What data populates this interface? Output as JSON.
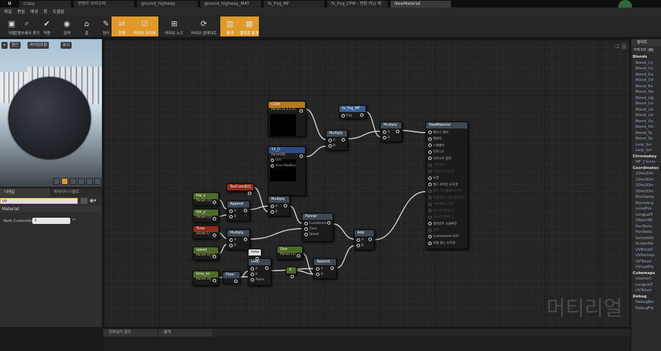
{
  "tabs": [
    "crazy",
    "콘텐츠 브라우저",
    "ground_highway",
    "ground_highway_MAT",
    "fx_Fog_MF",
    "fx_Fog_CPM - 변환 러닝 에",
    "NewMaterial"
  ],
  "menu": [
    "파일",
    "편집",
    "애셋",
    "창",
    "도움말"
  ],
  "toolbar": [
    {
      "label": "저장",
      "icon": "save-icon",
      "glyph": "▣",
      "active": false
    },
    {
      "label": "콘텐츠에서 찾기",
      "icon": "search-icon",
      "glyph": "⌕",
      "active": false
    },
    {
      "label": "적용",
      "icon": "check-icon",
      "glyph": "✔",
      "active": false
    },
    {
      "label": "검색",
      "icon": "binoculars-icon",
      "glyph": "◉",
      "active": false
    },
    {
      "label": "홈",
      "icon": "home-icon",
      "glyph": "⌂",
      "active": false
    },
    {
      "label": "정리",
      "icon": "broom-icon",
      "glyph": "✎",
      "active": false
    },
    {
      "label": "연결",
      "icon": "connect-icon",
      "glyph": "⇄",
      "active": true
    },
    {
      "label": "라이브 프리뷰",
      "icon": "preview-icon",
      "glyph": "☑",
      "active": true
    },
    {
      "label": "라이브 노드",
      "icon": "live-node-icon",
      "glyph": "⊞",
      "active": false
    },
    {
      "label": "라이브 업데이트",
      "icon": "live-update-icon",
      "glyph": "⟳",
      "active": false
    },
    {
      "label": "통계",
      "icon": "stats-icon",
      "glyph": "▥",
      "active": true
    },
    {
      "label": "플랫폼 통계",
      "icon": "platform-stats-icon",
      "glyph": "▦",
      "active": true
    }
  ],
  "viewport": {
    "btn_perspective": "원근",
    "btn_lit": "라이팅포함",
    "btn_show": "표시"
  },
  "details": {
    "tab1": "디테일",
    "tab2": "파라미터 디폴트",
    "search_value": "uv",
    "section": "Material",
    "prop_label": "Num Customized UVs",
    "prop_value": "1"
  },
  "graph": {
    "zoom": "-2 줌",
    "watermark": "머티리얼"
  },
  "nodes": [
    {
      "id": "color",
      "title": "Color",
      "sub": "Param (1,1,1,1)",
      "color": "#b7771b"
    },
    {
      "id": "tex",
      "title": "TX_D",
      "sub": "Param2D",
      "color": "#2a4c80",
      "pins": [
        "UVs",
        "View MipBias"
      ]
    },
    {
      "id": "fogmf",
      "title": "fx_Fog_MF",
      "color": "#3a5d94",
      "pins": [
        "Fog"
      ]
    },
    {
      "id": "mul1",
      "title": "Multiply",
      "pins": [
        "A",
        "B"
      ]
    },
    {
      "id": "mul2",
      "title": "Multiply",
      "pins": [
        "A",
        "B"
      ]
    },
    {
      "id": "texcoord",
      "title": "TexCoord[0]",
      "color": "#8d2a1a"
    },
    {
      "id": "tilex",
      "title": "tile_x",
      "sub": "Param (1)",
      "color": "#4d6b25"
    },
    {
      "id": "tiley",
      "title": "tile_y",
      "sub": "Param (1)",
      "color": "#4d6b25"
    },
    {
      "id": "append1",
      "title": "Append",
      "pins": [
        "A",
        "B"
      ]
    },
    {
      "id": "mul3",
      "title": "Multiply",
      "pins": [
        "A",
        "B"
      ]
    },
    {
      "id": "time",
      "title": "Time",
      "sub": "(Scale 1)",
      "color": "#8d2a1a"
    },
    {
      "id": "mul4",
      "title": "Multiply",
      "pins": [
        "A",
        "B"
      ]
    },
    {
      "id": "panner",
      "title": "Panner",
      "pins": [
        "Coordinate",
        "Time",
        "Speed"
      ]
    },
    {
      "id": "add",
      "title": "Add",
      "pins": [
        "A",
        "B"
      ]
    },
    {
      "id": "speed",
      "title": "speed",
      "sub": "Param (0.1)",
      "color": "#4d6b25"
    },
    {
      "id": "lerp",
      "title": "Lerp",
      "pins": [
        "A",
        "B",
        "Alpha"
      ]
    },
    {
      "id": "one",
      "title": "One",
      "sub": "Param (1)",
      "color": "#4d6b25"
    },
    {
      "id": "append2",
      "title": "Append",
      "pins": [
        "A",
        "B"
      ]
    },
    {
      "id": "timeon",
      "title": "time_on",
      "sub": "Param (0)",
      "color": "#4d6b25"
    },
    {
      "id": "floor",
      "title": "Floor"
    },
    {
      "id": "zero",
      "title": "0",
      "color": "#4d6b25"
    },
    {
      "id": "timecomment",
      "title": "time"
    },
    {
      "id": "result",
      "title": "NewMaterial",
      "pins": [
        "베이스 컬러",
        "메탈릭",
        "스페큘러",
        "러프니스",
        "이미시브 컬러",
        "오파시티",
        "오파시티 마스크",
        "노멀",
        "월드 포지션 오프셋",
        "월드 디스플레이스먼트",
        "테셀레이션 멀티플라이어",
        "서브서피스 컬러",
        "커스텀 데이터 0",
        "커스텀 데이터 1",
        "앰비언트 오클루전",
        "굴절",
        "Customized UV0",
        "픽셀 뎁스 오프셋"
      ]
    }
  ],
  "bottom": {
    "tab1": "컴파일러 결과",
    "tab2": "통계"
  },
  "palette": {
    "title": "팔레트",
    "filter": "카테고리",
    "filter_value": "All",
    "groups": [
      {
        "name": "Blends",
        "items": [
          "Blend_Co",
          "Blend_Co",
          "Blend_Da",
          "Blend_Dif",
          "Blend_Ex",
          "Blend_Ha",
          "Blend_Lig",
          "Blend_Lin",
          "Blend_Lin",
          "Blend_Lin",
          "Blend_Ov",
          "Blend_Pin",
          "Blend_Sc",
          "Blend_So",
          "Lerp_Scr",
          "Lerp_Scr"
        ]
      },
      {
        "name": "Chromakey",
        "items": [
          "MF_Chrom"
        ]
      },
      {
        "name": "Coordinates",
        "items": [
          "1Dto2DIn",
          "1Dto3DIn",
          "2Dto1DIn",
          "3Dto1DIn",
          "BlurSamp",
          "Bounding",
          "LocalPos",
          "LongLatT",
          "ObjectAli",
          "PanTextu",
          "PanTextu",
          "SampleSc",
          "ScreenRe",
          "UVBrickP",
          "UVRemap",
          "UVToLon",
          "VirtualPla"
        ]
      },
      {
        "name": "Cubemaps",
        "items": [
          "InteriorC",
          "LongLatT",
          "UVToLon"
        ]
      },
      {
        "name": "Debug",
        "items": [
          "DebugBin",
          "DebugFlo"
        ]
      }
    ]
  }
}
